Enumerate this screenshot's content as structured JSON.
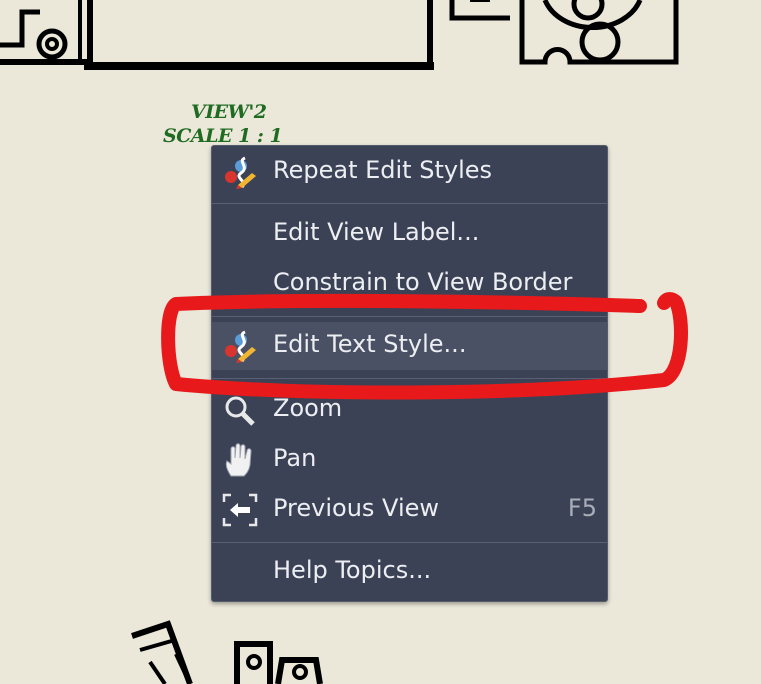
{
  "drawing": {
    "view_label_line1": "VIEW'2",
    "view_label_line2": "SCALE 1 : 1"
  },
  "context_menu": {
    "items": [
      {
        "label": "Repeat Edit Styles",
        "icon": "edit-styles-icon"
      },
      {
        "label": "Edit View Label..."
      },
      {
        "label": "Constrain to View Border"
      },
      {
        "label": "Edit Text Style...",
        "icon": "edit-styles-icon",
        "highlighted": true
      },
      {
        "label": "Zoom",
        "icon": "zoom-icon"
      },
      {
        "label": "Pan",
        "icon": "pan-hand-icon"
      },
      {
        "label": "Previous View",
        "icon": "previous-view-icon",
        "shortcut": "F5"
      },
      {
        "label": "Help Topics..."
      }
    ]
  },
  "annotation": {
    "color": "#e8191b"
  },
  "colors": {
    "menu_background": "#3c4255",
    "menu_text": "#eceef2",
    "canvas_background": "#ebe8da",
    "label_green": "#1f6b22"
  }
}
